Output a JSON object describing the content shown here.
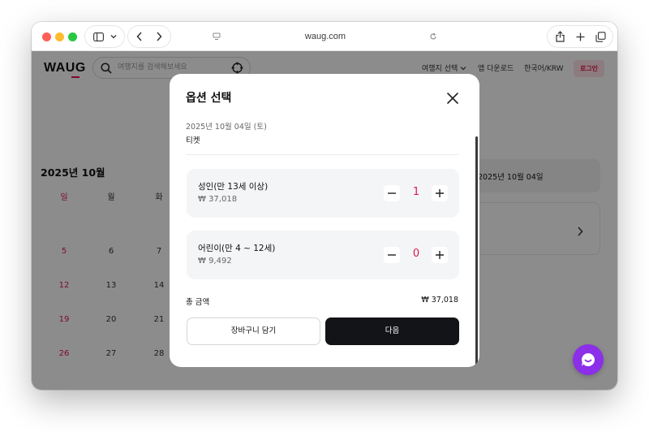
{
  "browser": {
    "url": "waug.com"
  },
  "site": {
    "logo": "WAUG",
    "search_placeholder": "여행지를 검색해보세요",
    "nav": {
      "destination": "여행지 선택",
      "app_download": "앱 다운로드",
      "locale": "한국어/KRW",
      "login": "로그인"
    }
  },
  "calendar": {
    "title": "2025년 10월",
    "weekdays": [
      "일",
      "월",
      "화"
    ],
    "rows": [
      [
        "5",
        "6",
        "7"
      ],
      [
        "12",
        "13",
        "14"
      ],
      [
        "19",
        "20",
        "21"
      ],
      [
        "26",
        "27",
        "28"
      ]
    ]
  },
  "side_panel": {
    "selected_date": "2025년 10월 04일"
  },
  "modal": {
    "title": "옵션 선택",
    "date": "2025년 10월 04일 (토)",
    "product": "티켓",
    "options": [
      {
        "name": "성인(만 13세 이상)",
        "price": "₩ 37,018",
        "qty": "1"
      },
      {
        "name": "어린이(만 4 ~ 12세)",
        "price": "₩ 9,492",
        "qty": "0"
      }
    ],
    "total_label": "총 금액",
    "total_value": "₩ 37,018",
    "cart_button": "장바구니 담기",
    "next_button": "다음"
  },
  "colors": {
    "accent": "#e0174f",
    "primary_button": "#121417",
    "chat_button": "#8b2fe8",
    "overlay": "rgba(0,0,0,0.45)"
  },
  "icons": {
    "close": "close-icon",
    "minus": "minus-icon",
    "plus": "plus-icon",
    "chat": "chat-icon"
  }
}
